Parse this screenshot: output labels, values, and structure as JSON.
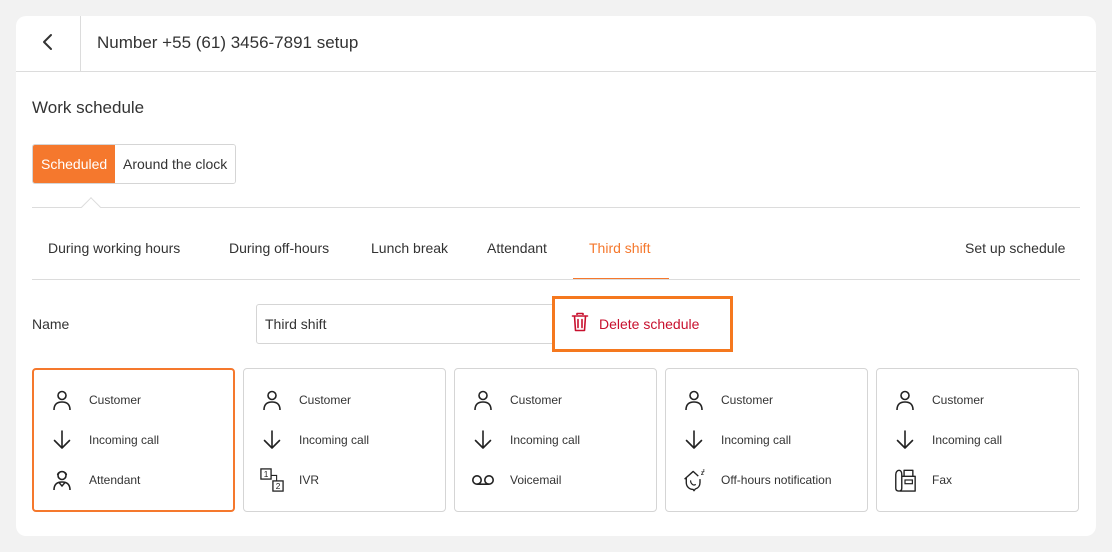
{
  "header": {
    "title": "Number +55 (61) 3456-7891 setup",
    "back_icon": "chevron-left-icon"
  },
  "work_schedule": {
    "title": "Work schedule",
    "modes": [
      {
        "label": "Scheduled",
        "active": true
      },
      {
        "label": "Around the clock",
        "active": false
      }
    ]
  },
  "tabs": [
    {
      "label": "During working hours",
      "active": false
    },
    {
      "label": "During off-hours",
      "active": false
    },
    {
      "label": "Lunch break",
      "active": false
    },
    {
      "label": "Attendant",
      "active": false
    },
    {
      "label": "Third shift",
      "active": true
    },
    {
      "label": "Set up schedule",
      "active": false
    }
  ],
  "form": {
    "name_label": "Name",
    "name_value": "Third shift",
    "delete_label": "Delete schedule",
    "delete_icon": "trash-icon"
  },
  "colors": {
    "accent": "#f5782d",
    "highlight_border": "#f5781e",
    "danger": "#c8102e"
  },
  "routing_cards": [
    {
      "selected": true,
      "rows": [
        {
          "icon": "person-icon",
          "label": "Customer"
        },
        {
          "icon": "arrow-down-icon",
          "label": "Incoming call"
        },
        {
          "icon": "attendant-icon",
          "label": "Attendant"
        }
      ]
    },
    {
      "selected": false,
      "rows": [
        {
          "icon": "person-icon",
          "label": "Customer"
        },
        {
          "icon": "arrow-down-icon",
          "label": "Incoming call"
        },
        {
          "icon": "ivr-icon",
          "label": "IVR"
        }
      ]
    },
    {
      "selected": false,
      "rows": [
        {
          "icon": "person-icon",
          "label": "Customer"
        },
        {
          "icon": "arrow-down-icon",
          "label": "Incoming call"
        },
        {
          "icon": "voicemail-icon",
          "label": "Voicemail"
        }
      ]
    },
    {
      "selected": false,
      "rows": [
        {
          "icon": "person-icon",
          "label": "Customer"
        },
        {
          "icon": "arrow-down-icon",
          "label": "Incoming call"
        },
        {
          "icon": "off-hours-icon",
          "label": "Off-hours notification"
        }
      ]
    },
    {
      "selected": false,
      "rows": [
        {
          "icon": "person-icon",
          "label": "Customer"
        },
        {
          "icon": "arrow-down-icon",
          "label": "Incoming call"
        },
        {
          "icon": "fax-icon",
          "label": "Fax"
        }
      ]
    }
  ]
}
